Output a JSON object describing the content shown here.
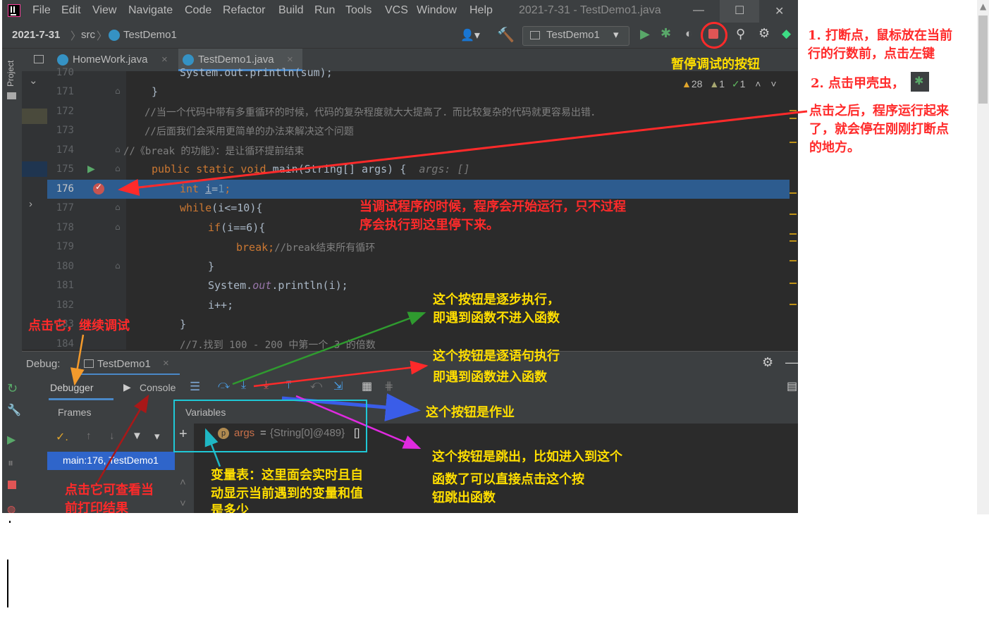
{
  "window": {
    "title": "2021-7-31 - TestDemo1.java",
    "menu": [
      "File",
      "Edit",
      "View",
      "Navigate",
      "Code",
      "Refactor",
      "Build",
      "Run",
      "Tools",
      "VCS",
      "Window",
      "Help"
    ],
    "controls": {
      "minimize": "—",
      "maximize": "☐",
      "close": "✕"
    }
  },
  "navbar": {
    "project": "2021-7-31",
    "folder": "src",
    "file": "TestDemo1",
    "run_config": "TestDemo1"
  },
  "tabs": [
    {
      "label": "HomeWork.java"
    },
    {
      "label": "TestDemo1.java",
      "active": true
    }
  ],
  "sidebar": {
    "project_label": "Project"
  },
  "inspections": {
    "warnings": "28",
    "weak": "1",
    "typos": "1"
  },
  "editor": {
    "lines": [
      {
        "n": "170",
        "text": "System.out.println(sum);"
      },
      {
        "n": "171",
        "text": "}"
      },
      {
        "n": "172",
        "text": "//当一个代码中带有多重循环的时候，代码的复杂程度就大大提高了．而比较复杂的代码就更容易出错．"
      },
      {
        "n": "173",
        "text": "//后面我们会采用更简单的办法来解决这个问题"
      },
      {
        "n": "174",
        "text": "//《break 的功能》：是让循环提前结束"
      },
      {
        "n": "175",
        "kw": "public static void",
        "rest": " main(String[] args) {",
        "hint": "args: []"
      },
      {
        "n": "176",
        "kw": "int",
        "rest": "i",
        "num": "1"
      },
      {
        "n": "177",
        "kw": "while",
        "rest": "(i<=10){"
      },
      {
        "n": "178",
        "kw": "if",
        "rest": "(i==6){"
      },
      {
        "n": "179",
        "kw": "break;",
        "comment": "//break结束所有循环"
      },
      {
        "n": "180",
        "text": "}"
      },
      {
        "n": "181",
        "pre": "System.",
        "fld": "out",
        "rest": ".println(i);"
      },
      {
        "n": "182",
        "text": "i++;"
      },
      {
        "n": "183",
        "text": "}"
      },
      {
        "n": "184",
        "comment": "//7.找到 100 - 200 中第一个 3 的倍数"
      }
    ]
  },
  "debug": {
    "label": "Debug:",
    "session": "TestDemo1",
    "tabs": {
      "debugger": "Debugger",
      "console": "Console"
    },
    "frames_header": "Frames",
    "frame": "main:176, TestDemo1",
    "variables_header": "Variables",
    "variable": {
      "name": "args",
      "value": "{String[0]@489}",
      "extra": "[]"
    }
  },
  "annotations": {
    "pause_button": "暂停调试的按钮",
    "step1_l1": "1. 打断点，鼠标放在当前",
    "step1_l2": "行的行数前，点击左键",
    "step2": "2. 点击甲壳虫，",
    "after_l1": "点击之后，程序运行起来",
    "after_l2": "了，就会停在刚刚打断点",
    "after_l3": "的地方。",
    "stop_l1": "当调试程序的时候，程序会开始运行，只不过程",
    "stop_l2": "序会执行到这里停下来。",
    "resume": "点击它，继续调试",
    "step_over_l1": "这个按钮是逐步执行，",
    "step_over_l2": "即遇到函数不进入函数",
    "step_into_l1": "这个按钮是逐语句执行",
    "step_into_l2": "即遇到函数进入函数",
    "homework": "这个按钮是作业",
    "step_out_l1": "这个按钮是跳出，比如进入到这个",
    "step_out_l2": "函数了可以直接点击这个按",
    "step_out_l3": "钮跳出函数",
    "vars_l1": "变量表：这里面会实时且自",
    "vars_l2": "动显示当前遇到的变量和值",
    "vars_l3": "是多少",
    "console_l1": "点击它可查看当",
    "console_l2": "前打印结果"
  },
  "colors": {
    "accent_red": "#ff2a2a",
    "annotation_yellow": "#ffde00",
    "ide_bg": "#2b2b2b",
    "highlight_row": "#2d5c8f"
  }
}
